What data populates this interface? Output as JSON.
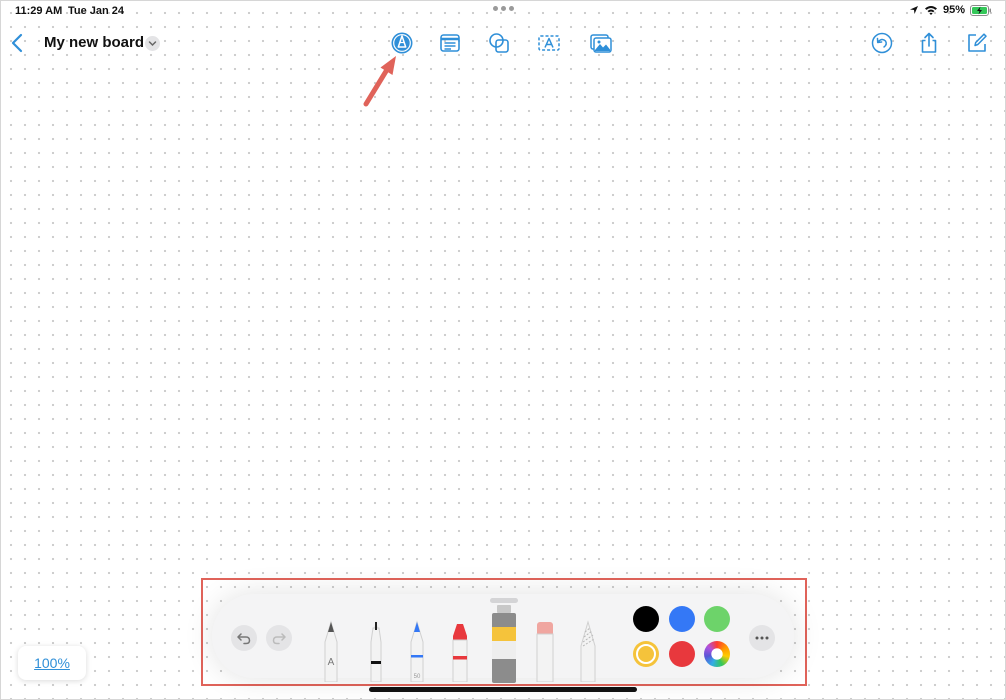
{
  "status_bar": {
    "time": "11:29 AM",
    "date": "Tue Jan 24",
    "battery": "95%"
  },
  "nav": {
    "title": "My new board",
    "tools": [
      "pen-tool-icon",
      "note-icon",
      "shapes-icon",
      "text-box-icon",
      "media-icon"
    ],
    "right_actions": [
      "undo-history-icon",
      "share-icon",
      "compose-icon"
    ]
  },
  "drawing_toolbar": {
    "tools": [
      "pencil",
      "fineliner",
      "ballpoint-pen",
      "crayon",
      "paint-tube",
      "eraser",
      "lasso-pencil"
    ],
    "pen_size_label": "50",
    "pencil_label": "A",
    "colors": [
      "#000000",
      "#3478f6",
      "#6dd36a",
      "#f5c33b",
      "#e8383d"
    ],
    "selected_color": "#f5c33b"
  },
  "zoom_level": "100%",
  "colors": {
    "accent": "#2f8fd8",
    "annotation": "#e0635a"
  }
}
